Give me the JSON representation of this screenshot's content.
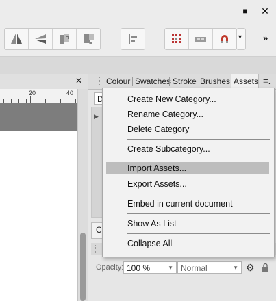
{
  "window": {
    "minimize": "–",
    "maximize": "■",
    "close": "✕"
  },
  "toolbar": {
    "icons": [
      "flip-horizontal-icon",
      "flip-vertical-icon",
      "rotate-left-icon",
      "rotate-right-icon",
      "align-icon",
      "snapping-grid-icon",
      "snapping-box-icon",
      "snapping-magnet-icon",
      "dropdown-arrow-icon",
      "more-icon"
    ],
    "more_label": "»",
    "dropdown_label": "▾"
  },
  "document": {
    "close_label": "✕",
    "ruler_ticks": [
      "20",
      "40"
    ]
  },
  "panel": {
    "tabs": [
      "Colour",
      "Swatches",
      "Stroke",
      "Brushes",
      "Assets"
    ],
    "active_tab": "Assets",
    "menu_icon": "≡.",
    "category_partial": "D",
    "lower_partial": "C",
    "opacity_label": "Opacity:",
    "opacity_value": "100 %",
    "blend_mode": "Normal"
  },
  "menu": {
    "items": [
      "Create New Category...",
      "Rename Category...",
      "Delete Category",
      "Create Subcategory...",
      "Import Assets...",
      "Export Assets...",
      "Embed in current document",
      "Show As List",
      "Collapse All"
    ],
    "highlighted": "Import Assets..."
  }
}
